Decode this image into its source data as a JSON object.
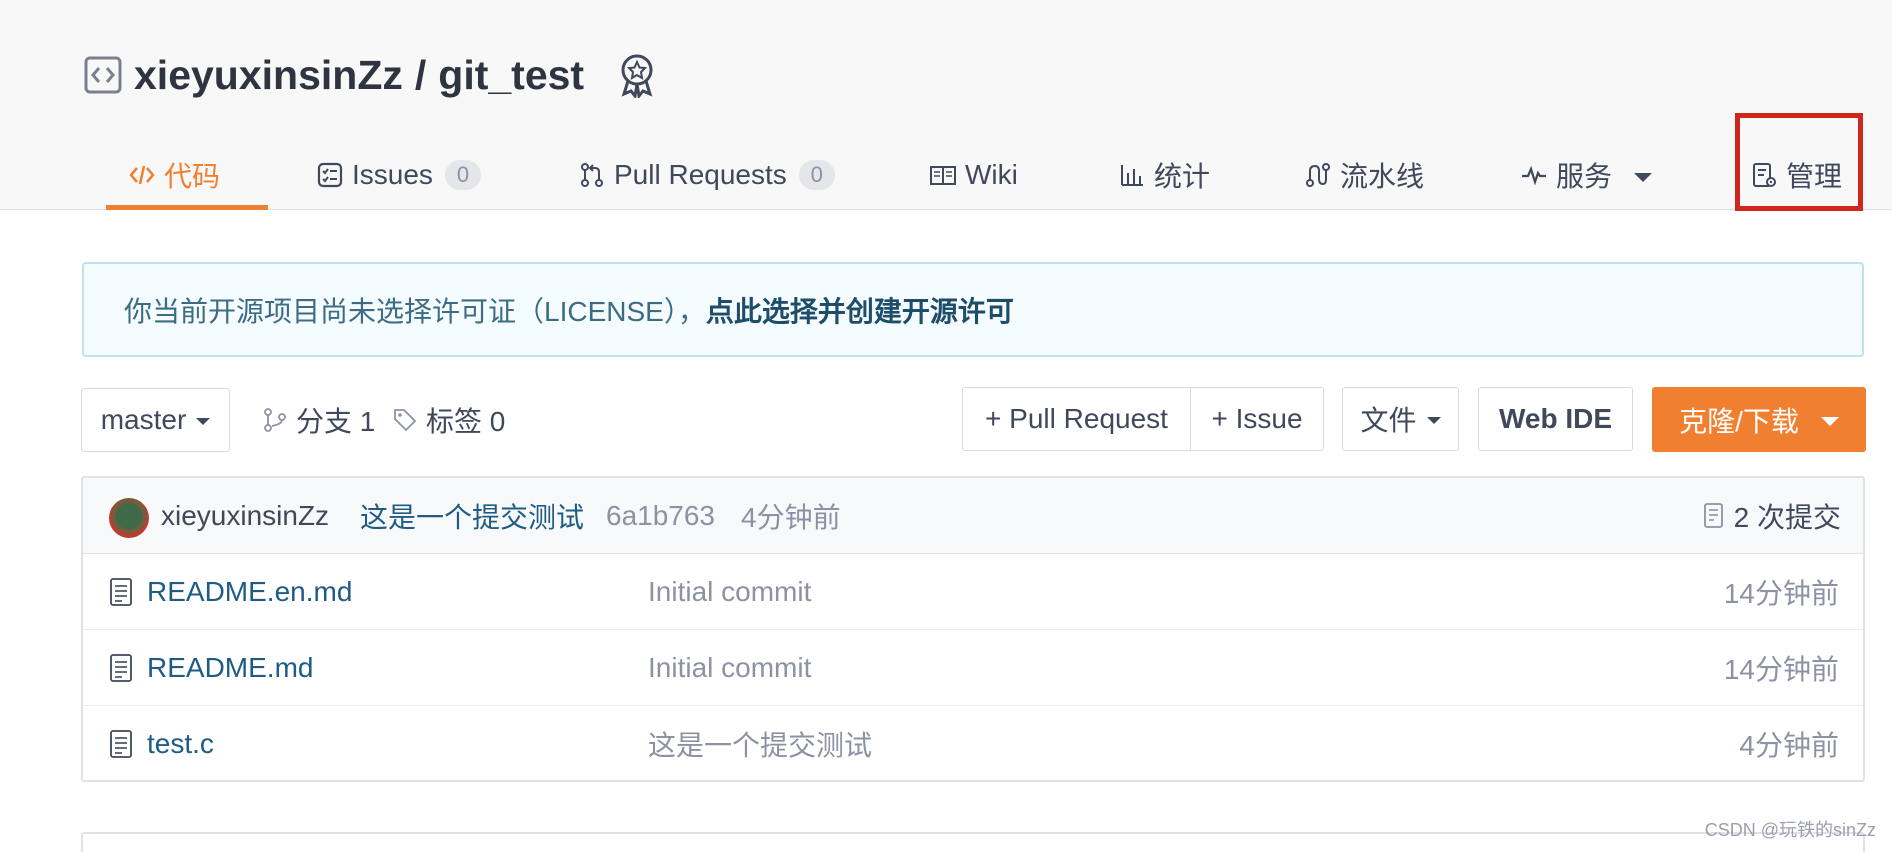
{
  "repo": {
    "owner": "xieyuxinsinZz",
    "separator": "/",
    "name": "git_test"
  },
  "tabs": [
    {
      "label": "代码",
      "icon": "code-icon"
    },
    {
      "label": "Issues",
      "icon": "issues-icon",
      "count": "0"
    },
    {
      "label": "Pull Requests",
      "icon": "pull-request-icon",
      "count": "0"
    },
    {
      "label": "Wiki",
      "icon": "wiki-icon"
    },
    {
      "label": "统计",
      "icon": "chart-icon"
    },
    {
      "label": "流水线",
      "icon": "pipeline-icon"
    },
    {
      "label": "服务",
      "icon": "pulse-icon"
    },
    {
      "label": "管理",
      "icon": "settings-doc-icon"
    }
  ],
  "active_tab": "代码",
  "notice": {
    "text": "你当前开源项目尚未选择许可证（LICENSE），",
    "link": "点此选择并创建开源许可"
  },
  "toolbar": {
    "branch": "master",
    "branches": "分支 1",
    "tags": "标签 0",
    "pull_request": "+ Pull Request",
    "issue": "+ Issue",
    "file": "文件",
    "web_ide": "Web IDE",
    "clone": "克隆/下载"
  },
  "last_commit": {
    "author": "xieyuxinsinZz",
    "message": "这是一个提交测试",
    "hash": "6a1b763",
    "time": "4分钟前",
    "commit_count": "2 次提交"
  },
  "files": [
    {
      "name": "README.en.md",
      "message": "Initial commit",
      "time": "14分钟前"
    },
    {
      "name": "README.md",
      "message": "Initial commit",
      "time": "14分钟前"
    },
    {
      "name": "test.c",
      "message": "这是一个提交测试",
      "time": "4分钟前"
    }
  ],
  "watermark": "CSDN @玩铁的sinZz",
  "colors": {
    "accent": "#f0802f",
    "highlight_box": "#d0271d",
    "link": "#1f5c85"
  }
}
